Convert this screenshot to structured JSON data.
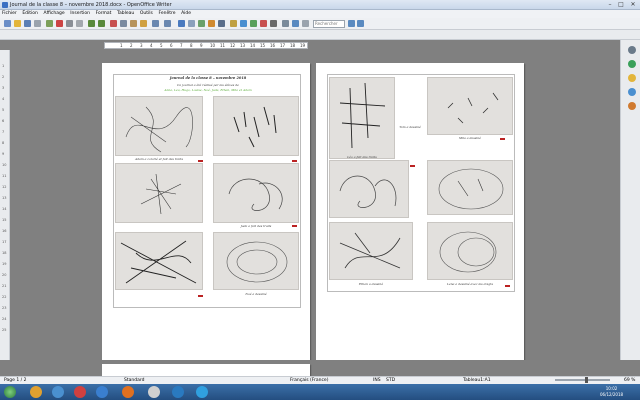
{
  "window": {
    "title": "Journal de la classe 8 – novembre 2018.docx - OpenOffice Writer",
    "controls": [
      "–",
      "□",
      "✕"
    ]
  },
  "menu": [
    "Fichier",
    "Édition",
    "Affichage",
    "Insertion",
    "Format",
    "Tableau",
    "Outils",
    "Fenêtre",
    "Aide"
  ],
  "toolbar": {
    "search_placeholder": "Rechercher"
  },
  "ruler": {
    "numbers": [
      "1",
      "2",
      "3",
      "4",
      "5",
      "6",
      "7",
      "8",
      "9",
      "10",
      "11",
      "12",
      "13",
      "14",
      "15",
      "16",
      "17",
      "18",
      "19"
    ]
  },
  "vruler": {
    "numbers": [
      "1",
      "2",
      "3",
      "4",
      "5",
      "6",
      "7",
      "8",
      "9",
      "10",
      "11",
      "12",
      "13",
      "14",
      "15",
      "16",
      "17",
      "18",
      "19",
      "20",
      "21",
      "22",
      "23",
      "24",
      "25"
    ]
  },
  "document": {
    "page1": {
      "heading": "Journal de la classe 8 – novembre 2018",
      "subheading": "Ce journal a été réalisé par les élèves de",
      "names": "Anna, Lea, Hugo, Louise, Noé, Jade, Ethan, Mila et Adam",
      "captions": [
        "Adam a colorié et fait des traits",
        "",
        "",
        "Jade a fait des traits",
        "",
        "Noé a dessiné"
      ]
    },
    "page2": {
      "captions": [
        "Tom a dessiné",
        "Mila a dessiné",
        "Léo a fait des traits",
        "",
        "Ethan a dessiné",
        "Lena a dessiné avec les doigts"
      ]
    }
  },
  "status": {
    "page": "Page 1 / 2",
    "style": "Standard",
    "language": "Français (France)",
    "ins": "INS",
    "std": "STD",
    "table": "Tableau1:A1",
    "zoom": "69 %"
  },
  "taskbar": {
    "clock_time": "10:02",
    "clock_date": "06/12/2018"
  }
}
